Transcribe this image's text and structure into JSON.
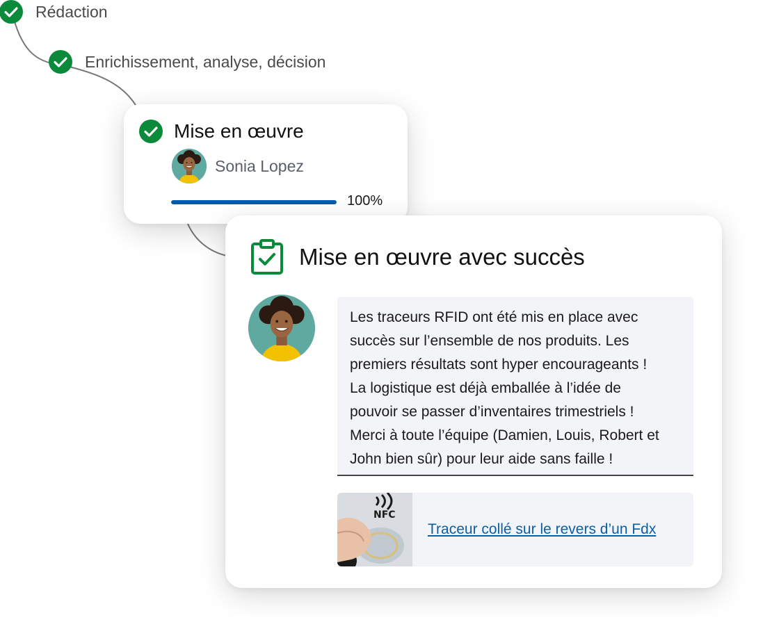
{
  "steps": [
    {
      "label": "Rédaction",
      "status": "done"
    },
    {
      "label": "Enrichissement, analyse, décision",
      "status": "done"
    }
  ],
  "current_step": {
    "title": "Mise en œuvre",
    "assignee": "Sonia Lopez",
    "progress_percent": 100,
    "progress_label": "100%"
  },
  "success_card": {
    "title": "Mise en œuvre avec succès",
    "message_lines": [
      "Les traceurs RFID ont été mis en place avec",
      "succès sur l’ensemble de nos produits. Les",
      "premiers résultats sont hyper encourageants !",
      "La logistique est déjà emballée à l’idée de",
      "pouvoir se passer d’inventaires trimestriels !",
      "Merci à toute l’équipe (Damien, Louis, Robert et",
      "John bien sûr) pour leur aide sans faille !"
    ],
    "attachment": {
      "link_text": "Traceur collé sur le revers d’un Fdx",
      "thumb_text": "NFC"
    }
  },
  "colors": {
    "check_green": "#0a8a3a",
    "progress_blue": "#005ba8",
    "link_blue": "#0b5fa5",
    "message_bg": "#f2f4f8",
    "avatar_bg": "#5fa9a0"
  },
  "icons": {
    "step_done": "check-circle-icon",
    "success": "clipboard-check-icon"
  }
}
